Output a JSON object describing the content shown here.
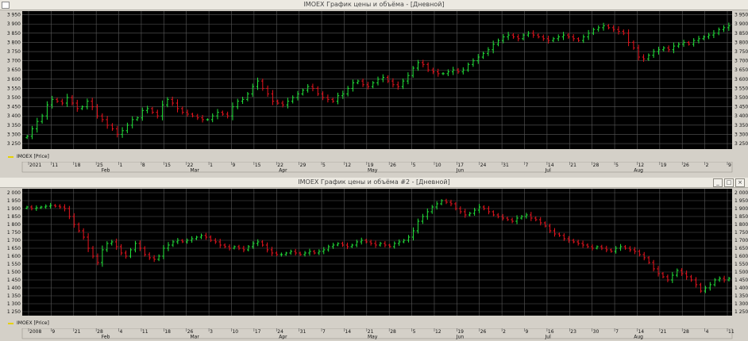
{
  "windows": [
    {
      "title": "IMOEX График цены и объёма - [Дневной]",
      "legend": "IMOEX [Price]",
      "chart_data": {
        "type": "bar",
        "subtype": "ohlc",
        "ylim": [
          3220,
          3970
        ],
        "yticks": [
          3250,
          3300,
          3350,
          3400,
          3450,
          3500,
          3550,
          3600,
          3650,
          3700,
          3750,
          3800,
          3850,
          3900,
          3950
        ],
        "ytick_labels": [
          "3 250",
          "3 300",
          "3 350",
          "3 400",
          "3 450",
          "3 500",
          "3 550",
          "3 600",
          "3 650",
          "3 700",
          "3 750",
          "3 800",
          "3 850",
          "3 900",
          "3 950"
        ],
        "x_ticks": [
          "2021",
          "11",
          "18",
          "25",
          "1",
          "8",
          "15",
          "22",
          "1",
          "9",
          "15",
          "22",
          "29",
          "5",
          "12",
          "19",
          "26",
          "5",
          "10",
          "17",
          "24",
          "31",
          "7",
          "14",
          "21",
          "28",
          "5",
          "12",
          "19",
          "26",
          "2",
          "9"
        ],
        "x_months": [
          "Feb",
          "Mar",
          "Apr",
          "May",
          "Jun",
          "Jul",
          "Aug"
        ],
        "closes": [
          3290,
          3330,
          3370,
          3400,
          3460,
          3490,
          3480,
          3470,
          3500,
          3470,
          3440,
          3450,
          3480,
          3450,
          3400,
          3380,
          3350,
          3330,
          3300,
          3320,
          3350,
          3380,
          3390,
          3430,
          3440,
          3420,
          3400,
          3460,
          3490,
          3470,
          3440,
          3420,
          3410,
          3400,
          3390,
          3380,
          3380,
          3400,
          3420,
          3410,
          3400,
          3450,
          3480,
          3490,
          3520,
          3560,
          3590,
          3550,
          3520,
          3480,
          3470,
          3460,
          3480,
          3500,
          3520,
          3540,
          3560,
          3550,
          3520,
          3500,
          3490,
          3480,
          3510,
          3520,
          3550,
          3580,
          3590,
          3570,
          3560,
          3580,
          3600,
          3610,
          3590,
          3570,
          3560,
          3590,
          3620,
          3660,
          3690,
          3680,
          3650,
          3640,
          3630,
          3630,
          3640,
          3650,
          3640,
          3650,
          3680,
          3700,
          3720,
          3740,
          3760,
          3790,
          3810,
          3830,
          3840,
          3830,
          3820,
          3840,
          3850,
          3840,
          3830,
          3820,
          3810,
          3820,
          3830,
          3840,
          3830,
          3820,
          3810,
          3830,
          3850,
          3870,
          3880,
          3890,
          3880,
          3870,
          3860,
          3850,
          3800,
          3770,
          3720,
          3710,
          3730,
          3750,
          3760,
          3770,
          3760,
          3780,
          3790,
          3800,
          3790,
          3810,
          3820,
          3830,
          3840,
          3850,
          3870,
          3880,
          3890
        ]
      }
    },
    {
      "title": "IMOEX График цены и объёма #2 - [Дневной]",
      "legend": "IMOEX [Price]",
      "chart_data": {
        "type": "bar",
        "subtype": "ohlc",
        "ylim": [
          1225,
          2025
        ],
        "yticks": [
          1250,
          1300,
          1350,
          1400,
          1450,
          1500,
          1550,
          1600,
          1650,
          1700,
          1750,
          1800,
          1850,
          1900,
          1950,
          2000
        ],
        "ytick_labels": [
          "1 250",
          "1 300",
          "1 350",
          "1 400",
          "1 450",
          "1 500",
          "1 550",
          "1 600",
          "1 650",
          "1 700",
          "1 750",
          "1 800",
          "1 850",
          "1 900",
          "1 950",
          "2 000"
        ],
        "x_ticks": [
          "2008",
          "9",
          "21",
          "28",
          "4",
          "11",
          "18",
          "26",
          "3",
          "10",
          "17",
          "24",
          "31",
          "7",
          "14",
          "21",
          "28",
          "5",
          "12",
          "19",
          "26",
          "2",
          "9",
          "16",
          "23",
          "30",
          "7",
          "14",
          "21",
          "28",
          "4",
          "11"
        ],
        "x_months": [
          "Feb",
          "Mar",
          "Apr",
          "May",
          "Jun",
          "Jul",
          "Aug"
        ],
        "closes": [
          1910,
          1900,
          1905,
          1910,
          1915,
          1920,
          1915,
          1910,
          1900,
          1850,
          1800,
          1760,
          1720,
          1650,
          1600,
          1560,
          1640,
          1680,
          1690,
          1660,
          1620,
          1600,
          1640,
          1680,
          1650,
          1610,
          1590,
          1580,
          1600,
          1650,
          1670,
          1690,
          1700,
          1690,
          1700,
          1710,
          1720,
          1730,
          1720,
          1700,
          1690,
          1670,
          1660,
          1650,
          1660,
          1650,
          1640,
          1660,
          1680,
          1690,
          1670,
          1640,
          1620,
          1610,
          1610,
          1620,
          1630,
          1620,
          1610,
          1620,
          1630,
          1620,
          1630,
          1640,
          1660,
          1670,
          1680,
          1670,
          1660,
          1670,
          1690,
          1700,
          1690,
          1680,
          1670,
          1680,
          1670,
          1660,
          1680,
          1690,
          1700,
          1720,
          1760,
          1820,
          1850,
          1880,
          1910,
          1930,
          1950,
          1940,
          1930,
          1900,
          1880,
          1860,
          1870,
          1890,
          1910,
          1900,
          1880,
          1860,
          1850,
          1840,
          1830,
          1820,
          1840,
          1850,
          1860,
          1840,
          1830,
          1810,
          1790,
          1760,
          1740,
          1730,
          1710,
          1700,
          1690,
          1680,
          1670,
          1660,
          1650,
          1660,
          1650,
          1640,
          1630,
          1650,
          1660,
          1650,
          1640,
          1630,
          1610,
          1590,
          1560,
          1520,
          1490,
          1470,
          1450,
          1480,
          1510,
          1490,
          1470,
          1450,
          1420,
          1380,
          1400,
          1420,
          1450,
          1460,
          1450,
          1460
        ]
      }
    }
  ],
  "colors": {
    "up": "#22e33a",
    "down": "#e8141e",
    "grid": "#5a5a5a",
    "background": "#000000",
    "axis_text": "#e0e0e0",
    "legend_line": "#e6d100"
  }
}
